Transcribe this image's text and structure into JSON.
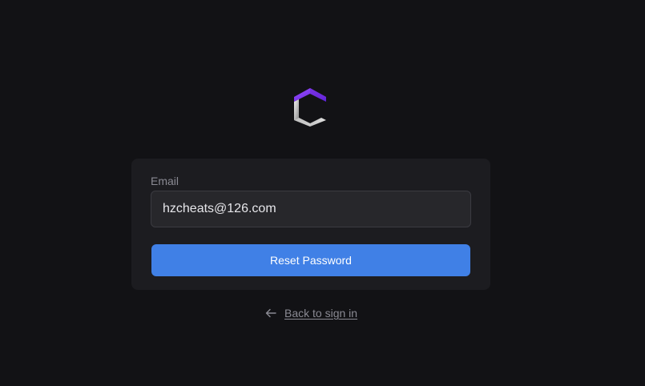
{
  "brand": {
    "logo_icon": "brand-logo-icon",
    "accent_color": "#7c3aed"
  },
  "form": {
    "email_label": "Email",
    "email_value": "hzcheats@126.com",
    "reset_button_label": "Reset Password",
    "button_color": "#4080e6"
  },
  "footer": {
    "back_icon": "arrow-left-icon",
    "back_label": "Back to sign in"
  }
}
